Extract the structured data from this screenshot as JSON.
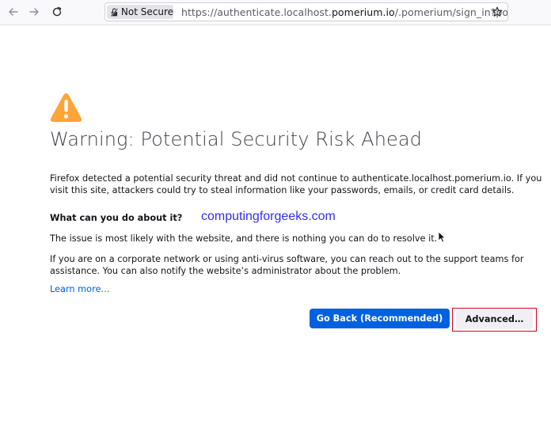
{
  "browser": {
    "back_icon": "arrow-left-icon",
    "forward_icon": "arrow-right-icon",
    "reload_icon": "reload-icon",
    "security_label": "Not Secure",
    "url_prefix": "https://authenticate.localhost.",
    "url_host": "pomerium.io",
    "url_suffix": "/.pomerium/sign_in?pome",
    "bookmark_icon": "star-icon"
  },
  "page": {
    "warning_icon": "warning-triangle-icon",
    "title": "Warning: Potential Security Risk Ahead",
    "intro": "Firefox detected a potential security threat and did not continue to authenticate.localhost.pomerium.io. If you visit this site, attackers could try to steal information like your passwords, emails, or credit card details.",
    "what_heading": "What can you do about it?",
    "watermark": "computingforgeeks.com",
    "issue_text": "The issue is most likely with the website, and there is nothing you can do to resolve it.",
    "corporate_text": "If you are on a corporate network or using anti-virus software, you can reach out to the support teams for assistance. You can also notify the website’s administrator about the problem.",
    "learn_more": "Learn more…",
    "go_back_button": "Go Back (Recommended)",
    "advanced_button": "Advanced…"
  },
  "colors": {
    "accent": "#0061e0",
    "warning": "#ffa436",
    "highlight_outline": "#d0021b"
  }
}
